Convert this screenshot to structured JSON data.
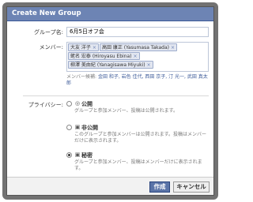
{
  "dialog": {
    "title": "Create New Group"
  },
  "form": {
    "group_name_label": "グループ名:",
    "group_name_value": "6月5日オフ会",
    "members_label": "メンバー:",
    "members": [
      "大友 洋子",
      "高田 康正 (Yasumasa Takada)",
      "蛯名 宏泰 (Hiroyasu Ebina)",
      "柳澤 美由紀 (Yanagisawa Miyuki)"
    ],
    "token_remove_glyph": "×",
    "suggestions_label": "メンバー候補:",
    "suggestions": "金田 和子, 岩色 佳代, 西田 京子, 汀 光一, 武田 真太郎",
    "privacy_label": "プライバシー:"
  },
  "privacy_options": [
    {
      "title": "公開",
      "description": "グループと参加メンバー、投稿は公開されます。",
      "checked": false,
      "icon": "globe-icon"
    },
    {
      "title": "非公開",
      "description": "このグループと参加メンバーは公開されます。投稿はメンバーだけに表示されます。",
      "checked": false,
      "icon": "lock-icon"
    },
    {
      "title": "秘密",
      "description": "グループと参加メンバー、投稿はメンバーだけに表示されます。",
      "checked": true,
      "icon": "lock-icon"
    }
  ],
  "buttons": {
    "create": "作成",
    "cancel": "キャンセル"
  },
  "colors": {
    "title_bar": "#6d84b4",
    "primary_button": "#5b74a8",
    "token_bg": "#e2e6f0"
  }
}
